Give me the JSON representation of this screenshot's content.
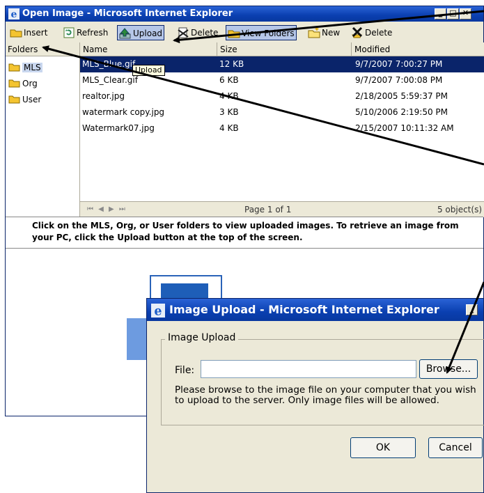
{
  "main_window": {
    "title": "Open Image - Microsoft Internet Explorer",
    "toolbar": {
      "insert": "Insert",
      "refresh": "Refresh",
      "upload": "Upload",
      "delete_file": "Delete",
      "view_folders": "View Folders",
      "new": "New",
      "delete": "Delete"
    },
    "tooltip": "Upload",
    "folders": {
      "header": "Folders",
      "items": [
        {
          "label": "MLS",
          "selected": true
        },
        {
          "label": "Org",
          "selected": false
        },
        {
          "label": "User",
          "selected": false
        }
      ]
    },
    "file_list": {
      "columns": {
        "name": "Name",
        "size": "Size",
        "modified": "Modified"
      },
      "rows": [
        {
          "name": "MLS_Blue.gif",
          "size": "12 KB",
          "modified": "9/7/2007 7:00:27 PM",
          "selected": true
        },
        {
          "name": "MLS_Clear.gif",
          "size": "6 KB",
          "modified": "9/7/2007 7:00:08 PM",
          "selected": false
        },
        {
          "name": "realtor.jpg",
          "size": "4 KB",
          "modified": "2/18/2005 5:59:37 PM",
          "selected": false
        },
        {
          "name": "watermark copy.jpg",
          "size": "3 KB",
          "modified": "5/10/2006 2:19:50 PM",
          "selected": false
        },
        {
          "name": "Watermark07.jpg",
          "size": "4 KB",
          "modified": "2/15/2007 10:11:32 AM",
          "selected": false
        }
      ],
      "pager": {
        "nav_icons": "⏮ ◀ ▶ ⏭",
        "page": "Page 1 of 1",
        "count": "5 object(s)"
      }
    },
    "instructions": "Click on the MLS, Org, or User folders to view uploaded images. To retrieve an image from your PC, click the Upload button at the top of the screen."
  },
  "upload_dialog": {
    "title": "Image Upload - Microsoft Internet Explorer",
    "group_label": "Image Upload",
    "file_label": "File:",
    "file_value": "",
    "browse": "Browse...",
    "description": "Please browse to the image file on your computer that you wish to upload to the server. Only image files will be allowed.",
    "ok": "OK",
    "cancel": "Cancel"
  },
  "colors": {
    "title_bar": "#0a3fb0",
    "window_face": "#ece9d8",
    "selection": "#0a246a",
    "folder_yellow": "#f4c430",
    "arrow": "#000000"
  }
}
